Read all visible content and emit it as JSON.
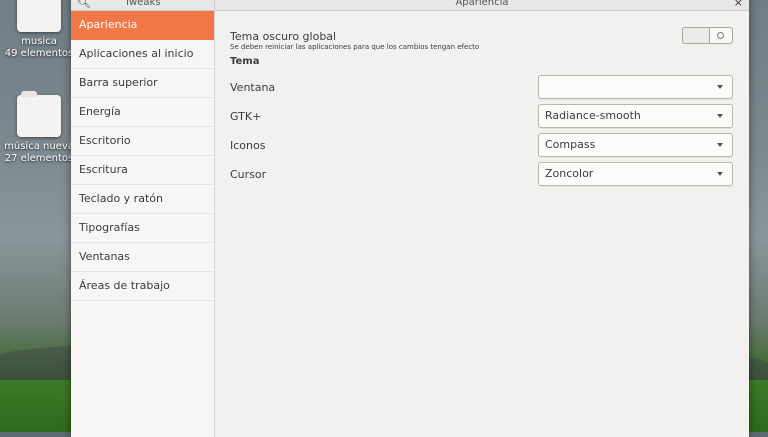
{
  "desktop": {
    "icons": [
      {
        "label": "musica",
        "sub": "49 elementos"
      },
      {
        "label": "música nueva",
        "sub": "27 elementos"
      }
    ]
  },
  "window": {
    "app_title": "Tweaks",
    "section_title": "Apariencia",
    "close_label": "×"
  },
  "sidebar": {
    "items": [
      {
        "label": "Apariencia"
      },
      {
        "label": "Aplicaciones al inicio"
      },
      {
        "label": "Barra superior"
      },
      {
        "label": "Energía"
      },
      {
        "label": "Escritorio"
      },
      {
        "label": "Escritura"
      },
      {
        "label": "Teclado y ratón"
      },
      {
        "label": "Tipografías"
      },
      {
        "label": "Ventanas"
      },
      {
        "label": "Áreas de trabajo"
      }
    ],
    "active_index": 0
  },
  "appearance": {
    "dark_theme_label": "Tema oscuro global",
    "dark_theme_hint": "Se deben reiniciar las aplicaciones para que los cambios tengan efecto",
    "dark_theme_on": false,
    "theme_heading": "Tema",
    "rows": [
      {
        "label": "Ventana",
        "value": ""
      },
      {
        "label": "GTK+",
        "value": "Radiance-smooth"
      },
      {
        "label": "Iconos",
        "value": "Compass"
      },
      {
        "label": "Cursor",
        "value": "Zoncolor"
      }
    ]
  },
  "colors": {
    "accent": "#f07746",
    "window_bg": "#f2f1f0"
  }
}
